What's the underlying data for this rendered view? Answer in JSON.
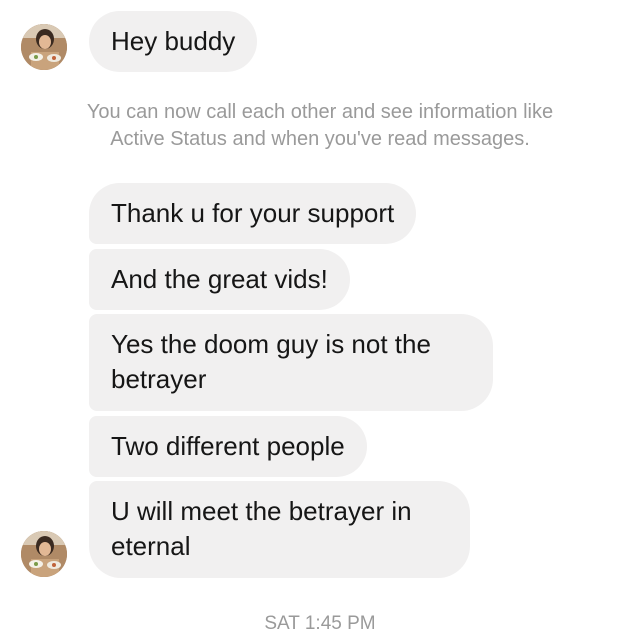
{
  "thread": {
    "first_message": "Hey buddy",
    "system_note_line1": "You can now call each other and see information like",
    "system_note_line2": "Active Status and when you've read messages.",
    "messages": [
      "Thank u for your support",
      "And the great vids!",
      "Yes the doom guy is not the betrayer",
      "Two different people",
      "U will meet the betrayer in eternal"
    ],
    "timestamp": "SAT 1:45 PM"
  },
  "colors": {
    "bubble_bg": "#f1f0f0",
    "system_text": "#9a9a9a"
  },
  "icons": {
    "avatar": "contact-profile-photo"
  }
}
